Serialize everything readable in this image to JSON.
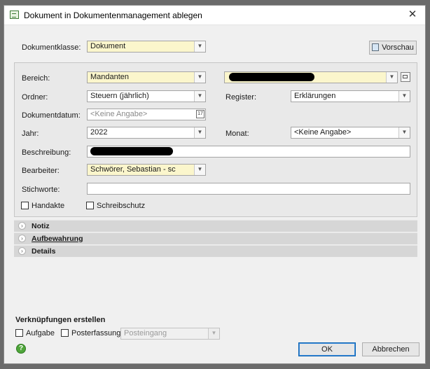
{
  "window": {
    "title": "Dokument in Dokumentenmanagement ablegen",
    "close_glyph": "✕"
  },
  "dokumentklasse": {
    "label": "Dokumentklasse:",
    "value": "Dokument"
  },
  "vorschau_button": "Vorschau",
  "form": {
    "bereich": {
      "label": "Bereich:",
      "value": "Mandanten"
    },
    "ordner": {
      "label": "Ordner:",
      "value": "Steuern (jährlich)"
    },
    "register": {
      "label": "Register:",
      "value": "Erklärungen"
    },
    "dokumentdatum": {
      "label": "Dokumentdatum:",
      "placeholder": "<Keine Angabe>"
    },
    "jahr": {
      "label": "Jahr:",
      "value": "2022"
    },
    "monat": {
      "label": "Monat:",
      "value": "<Keine Angabe>"
    },
    "beschreibung": {
      "label": "Beschreibung:"
    },
    "bearbeiter": {
      "label": "Bearbeiter:",
      "value": "Schwörer, Sebastian - sc"
    },
    "stichworte": {
      "label": "Stichworte:",
      "value": ""
    },
    "handakte": {
      "label": "Handakte"
    },
    "schreibschutz": {
      "label": "Schreibschutz"
    }
  },
  "sections": [
    {
      "title": "Notiz"
    },
    {
      "title": "Aufbewahrung"
    },
    {
      "title": "Details"
    }
  ],
  "links": {
    "heading": "Verknüpfungen erstellen",
    "aufgabe": "Aufgabe",
    "posterfassung": "Posterfassung:",
    "posteingang": "Posteingang"
  },
  "buttons": {
    "ok": "OK",
    "abbrechen": "Abbrechen"
  },
  "help_glyph": "?"
}
